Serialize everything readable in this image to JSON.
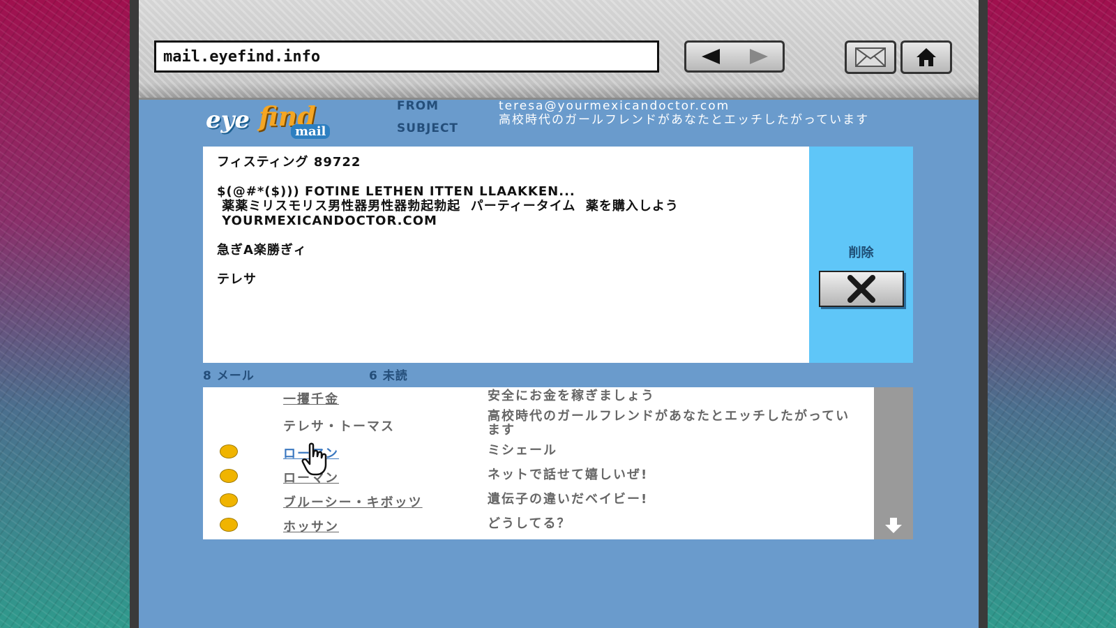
{
  "browser": {
    "address": "mail.eyefind.info"
  },
  "logo": {
    "eye": "eye",
    "find": "find",
    "mail": "mail"
  },
  "header": {
    "from_label": "FROM",
    "subject_label": "SUBJECT",
    "from_value": "teresa@yourmexicandoctor.com",
    "subject_value": "高校時代のガールフレンドがあなたとエッチしたがっています"
  },
  "message": {
    "lines": [
      "フィスティング 89722",
      "",
      "$(@#*($))) FOTINE LETHEN ITTEN LLAAKKEN...",
      " 薬薬ミリスモリス男性器男性器勃起勃起  パーティータイム  薬を購入しよう",
      " YOURMEXICANDOCTOR.COM",
      "",
      "急ぎA楽勝ぎィ",
      "",
      "テレサ"
    ]
  },
  "actions": {
    "delete_label": "削除"
  },
  "counts": {
    "mail": "8 メール",
    "unread": "6 未読"
  },
  "inbox": {
    "rows": [
      {
        "unread": false,
        "sender": "一攫千金",
        "subject": "安全にお金を稼ぎましょう"
      },
      {
        "unread": false,
        "sender": "テレサ・トーマス",
        "subject": "高校時代のガールフレンドがあなたとエッチしたがっています"
      },
      {
        "unread": true,
        "sender": "ローマン",
        "subject": "ミシェール"
      },
      {
        "unread": true,
        "sender": "ローマン",
        "subject": "ネットで話せて嬉しいぜ!"
      },
      {
        "unread": true,
        "sender": "ブルーシー・キボッツ",
        "subject": "遺伝子の違いだベイビー!"
      },
      {
        "unread": true,
        "sender": "ホッサン",
        "subject": "どうしてる？"
      }
    ]
  },
  "colors": {
    "page_bg": "#6a9bcc",
    "side_panel": "#5fc6f8",
    "unread_dot": "#f0b400",
    "link": "#3b78c0"
  }
}
